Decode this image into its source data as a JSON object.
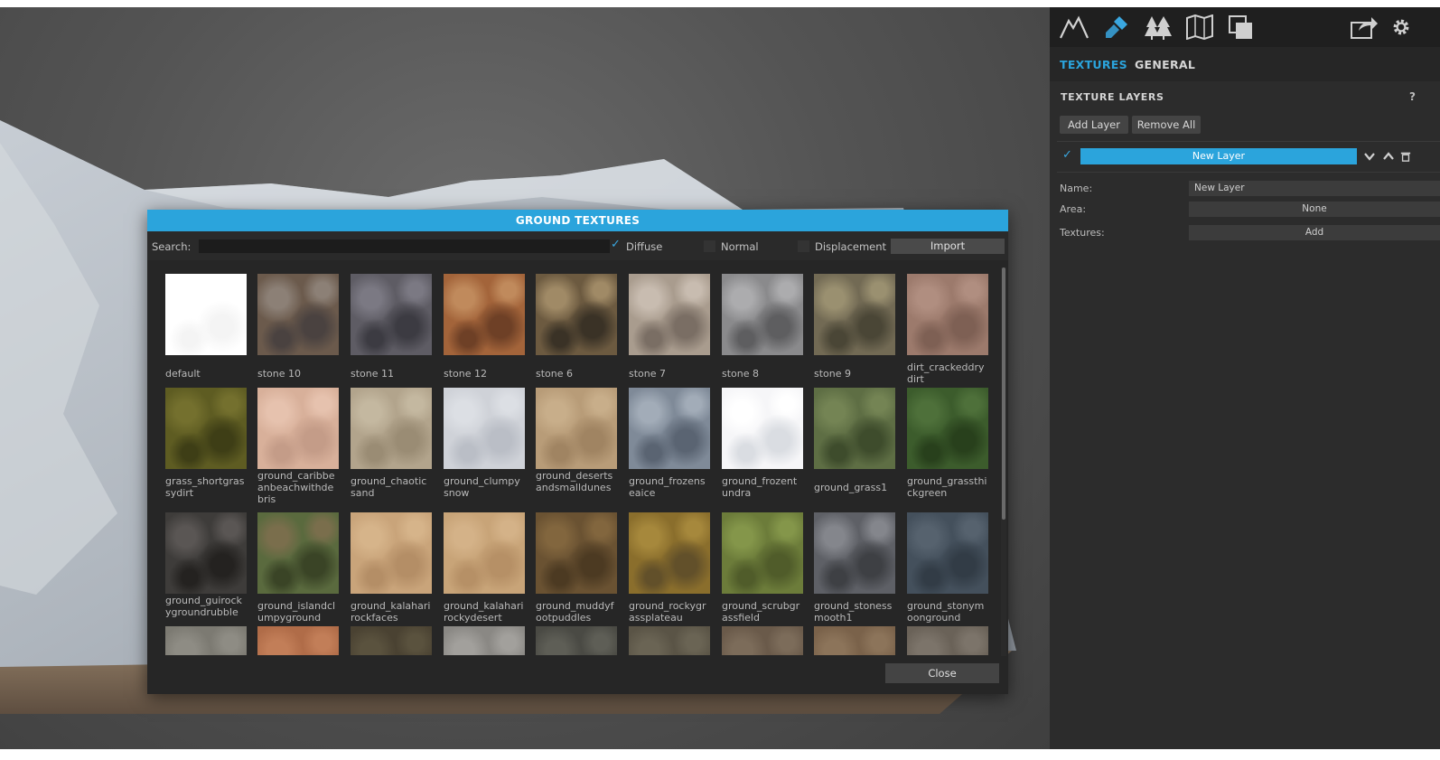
{
  "panel": {
    "tools": [
      {
        "icon": "mountain-icon",
        "active": false
      },
      {
        "icon": "paint-brush-icon",
        "active": true
      },
      {
        "icon": "trees-icon",
        "active": false
      },
      {
        "icon": "map-icon",
        "active": false
      },
      {
        "icon": "layers-icon",
        "active": false
      },
      {
        "icon": "export-icon",
        "active": false
      },
      {
        "icon": "gear-icon",
        "active": false
      }
    ],
    "tabs": [
      {
        "label": "TEXTURES",
        "active": true
      },
      {
        "label": "GENERAL",
        "active": false
      }
    ],
    "section_title": "TEXTURE LAYERS",
    "help": "?",
    "add_layer": "Add Layer",
    "remove_all": "Remove All",
    "layer": {
      "checked": "✓",
      "name": "New Layer"
    },
    "props": {
      "name_label": "Name:",
      "name_value": "New Layer",
      "area_label": "Area:",
      "area_value": "None",
      "textures_label": "Textures:",
      "textures_value": "Add"
    }
  },
  "dialog": {
    "title": "GROUND TEXTURES",
    "search_label": "Search:",
    "search_value": "",
    "diffuse": {
      "label": "Diffuse",
      "checked": true,
      "mark": "✓"
    },
    "normal": {
      "label": "Normal",
      "checked": false
    },
    "displacement": {
      "label": "Displacement",
      "checked": false
    },
    "import": "Import",
    "close": "Close",
    "textures": [
      {
        "name": "default",
        "colors": [
          "#ffffff",
          "#ffffff",
          "#f4f4f4"
        ]
      },
      {
        "name": "stone 10",
        "colors": [
          "#6b5a4c",
          "#8c8076",
          "#4a4240"
        ]
      },
      {
        "name": "stone 11",
        "colors": [
          "#5e5c64",
          "#7b7983",
          "#3c3b42"
        ]
      },
      {
        "name": "stone 12",
        "colors": [
          "#a3643a",
          "#c08a5c",
          "#6e4026"
        ]
      },
      {
        "name": "stone 6",
        "colors": [
          "#6c5a40",
          "#a08a66",
          "#3a3226"
        ]
      },
      {
        "name": "stone 7",
        "colors": [
          "#a99c8e",
          "#c8bcb0",
          "#7a6e64"
        ]
      },
      {
        "name": "stone 8",
        "colors": [
          "#8a8a8c",
          "#acacae",
          "#5e5e60"
        ]
      },
      {
        "name": "stone 9",
        "colors": [
          "#726a54",
          "#9a9070",
          "#4a4636"
        ]
      },
      {
        "name": "dirt_crackeddrydirt",
        "colors": [
          "#9c7a6c",
          "#b08e80",
          "#7e6054"
        ]
      },
      {
        "name": "grass_shortgrassydirt",
        "colors": [
          "#5e5c22",
          "#74702e",
          "#3e3e16"
        ]
      },
      {
        "name": "ground_caribbeanbeachwithdebris",
        "colors": [
          "#d8b09a",
          "#e6c2ae",
          "#c49c88"
        ]
      },
      {
        "name": "ground_chaoticsand",
        "colors": [
          "#b2a48c",
          "#c4b8a0",
          "#9a8c74"
        ]
      },
      {
        "name": "ground_clumpysnow",
        "colors": [
          "#cfd2d8",
          "#dcdfe4",
          "#babec6"
        ]
      },
      {
        "name": "ground_desertsandsmalldunes",
        "colors": [
          "#b89c78",
          "#c8ae8a",
          "#a08462"
        ]
      },
      {
        "name": "ground_frozenseaice",
        "colors": [
          "#7f8a98",
          "#a2acb8",
          "#5a6472"
        ]
      },
      {
        "name": "ground_frozentundra",
        "colors": [
          "#f6f6f8",
          "#ffffff",
          "#dadde2"
        ]
      },
      {
        "name": "ground_grass1",
        "colors": [
          "#5e6e44",
          "#748454",
          "#3e4c2c"
        ]
      },
      {
        "name": "ground_grassthickgreen",
        "colors": [
          "#3c5c2c",
          "#4e703a",
          "#28401c"
        ]
      },
      {
        "name": "ground_guirockygroundrubble",
        "colors": [
          "#3e3c3a",
          "#5a5654",
          "#242220"
        ]
      },
      {
        "name": "ground_islandclumpyground",
        "colors": [
          "#5a6a3e",
          "#7a6e4c",
          "#3a4426"
        ]
      },
      {
        "name": "ground_kalaharirockfaces",
        "colors": [
          "#c9a47a",
          "#d6b48a",
          "#b48e66"
        ]
      },
      {
        "name": "ground_kalaharirockydesert",
        "colors": [
          "#c8a478",
          "#d4b288",
          "#b69066"
        ]
      },
      {
        "name": "ground_muddyfootpuddles",
        "colors": [
          "#6a5232",
          "#82663e",
          "#4c3a22"
        ]
      },
      {
        "name": "ground_rockygrassplateau",
        "colors": [
          "#8a6e2c",
          "#a6883c",
          "#62502a"
        ]
      },
      {
        "name": "ground_scrubgrassfield",
        "colors": [
          "#6c7c3a",
          "#84964a",
          "#505c2a"
        ]
      },
      {
        "name": "ground_stonessmooth1",
        "colors": [
          "#5e6066",
          "#84868c",
          "#3e4044"
        ]
      },
      {
        "name": "ground_stonymoonground",
        "colors": [
          "#44505c",
          "#56626e",
          "#323c46"
        ]
      },
      {
        "name": "",
        "colors": [
          "#7c7a72",
          "#8e8c84",
          "#6a6860"
        ]
      },
      {
        "name": "",
        "colors": [
          "#b06c48",
          "#c27e58",
          "#94583a"
        ]
      },
      {
        "name": "",
        "colors": [
          "#4a4232",
          "#5a523e",
          "#3a3426"
        ]
      },
      {
        "name": "",
        "colors": [
          "#8a8884",
          "#a2a09c",
          "#6c6a66"
        ]
      },
      {
        "name": "",
        "colors": [
          "#4a4a44",
          "#5e5e56",
          "#383832"
        ]
      },
      {
        "name": "",
        "colors": [
          "#5a5446",
          "#6a6454",
          "#484236"
        ]
      },
      {
        "name": "",
        "colors": [
          "#6a5a4a",
          "#7c6c5a",
          "#56483a"
        ]
      },
      {
        "name": "",
        "colors": [
          "#7a624a",
          "#8c745a",
          "#665240"
        ]
      },
      {
        "name": "",
        "colors": [
          "#6a6258",
          "#7c746a",
          "#585046"
        ]
      }
    ]
  },
  "colors": {
    "accent": "#2ba4dc",
    "panel": "#2c2c2c",
    "dialog": "#262626"
  }
}
